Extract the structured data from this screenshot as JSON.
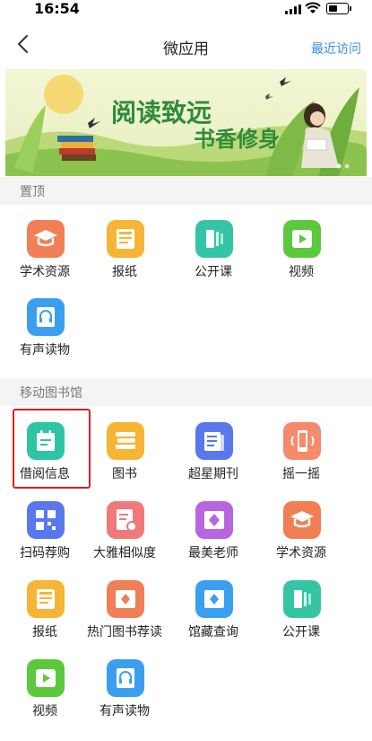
{
  "status": {
    "time": "16:54"
  },
  "nav": {
    "title": "微应用",
    "recent": "最近访问"
  },
  "banner": {
    "slogan_a": "阅读致远",
    "slogan_b": "书香修身"
  },
  "pinned": {
    "header": "置顶",
    "items": [
      {
        "label": "学术资源",
        "icon": "graduation-cap-icon",
        "color": "#f07f55"
      },
      {
        "label": "报纸",
        "icon": "newspaper-icon",
        "color": "#f6b534"
      },
      {
        "label": "公开课",
        "icon": "course-icon",
        "color": "#36c5a4"
      },
      {
        "label": "视频",
        "icon": "video-icon",
        "color": "#5cc93c"
      },
      {
        "label": "有声读物",
        "icon": "audiobook-icon",
        "color": "#3b9ff0"
      }
    ]
  },
  "library": {
    "header": "移动图书馆",
    "items": [
      {
        "label": "借阅信息",
        "icon": "borrow-info-icon",
        "color": "#2fc4a4"
      },
      {
        "label": "图书",
        "icon": "books-icon",
        "color": "#f6b534"
      },
      {
        "label": "超星期刊",
        "icon": "journal-icon",
        "color": "#5a78ee"
      },
      {
        "label": "摇一摇",
        "icon": "shake-icon",
        "color": "#f58a6c"
      },
      {
        "label": "扫码荐购",
        "icon": "qr-scan-icon",
        "color": "#5a78ee"
      },
      {
        "label": "大雅相似度",
        "icon": "similarity-icon",
        "color": "#f07a7a"
      },
      {
        "label": "最美老师",
        "icon": "teacher-icon",
        "color": "#b766e0"
      },
      {
        "label": "学术资源",
        "icon": "graduation-cap-icon",
        "color": "#f07f55"
      },
      {
        "label": "报纸",
        "icon": "newspaper-icon",
        "color": "#f6b534"
      },
      {
        "label": "热门图书荐读",
        "icon": "hot-books-icon",
        "color": "#f07f55"
      },
      {
        "label": "馆藏查询",
        "icon": "collection-search-icon",
        "color": "#3b9ff0"
      },
      {
        "label": "公开课",
        "icon": "course-icon",
        "color": "#36c5a4"
      },
      {
        "label": "视频",
        "icon": "video-icon",
        "color": "#5cc93c"
      },
      {
        "label": "有声读物",
        "icon": "audiobook-icon",
        "color": "#3b9ff0"
      }
    ]
  }
}
